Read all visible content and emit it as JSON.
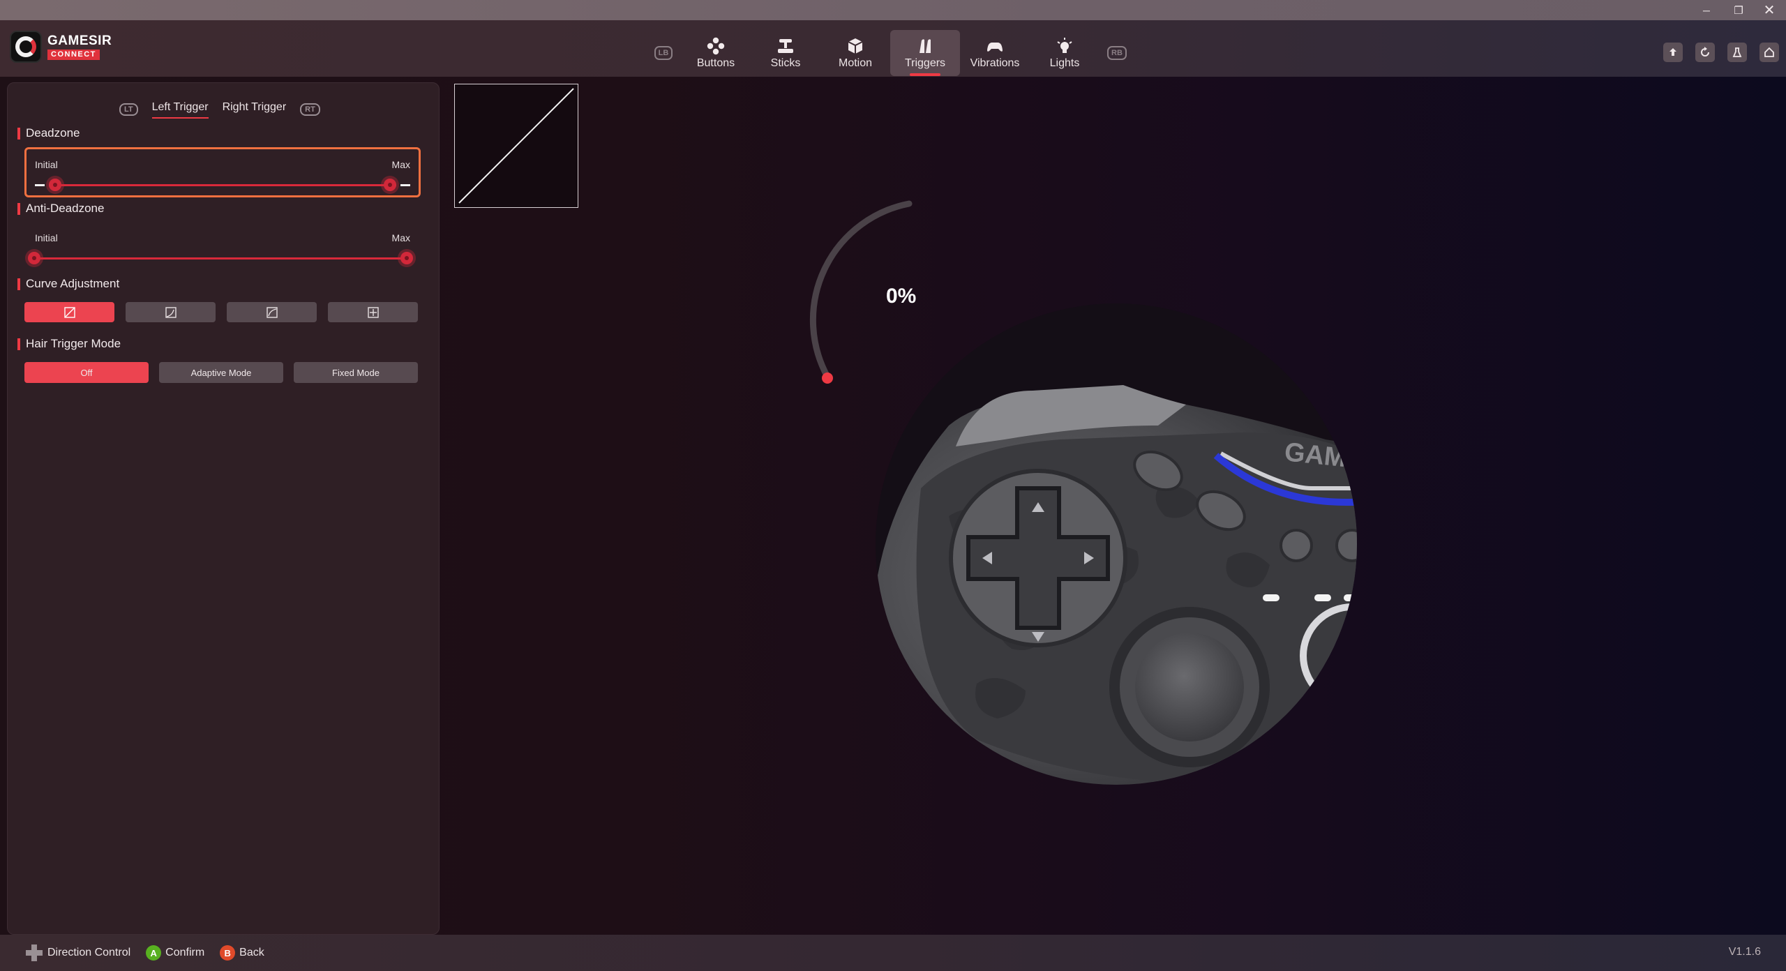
{
  "app": {
    "brand_line1": "GAMESIR",
    "brand_line2": "CONNECT",
    "version": "V1.1.6"
  },
  "window_controls": {
    "minimize_glyph": "─",
    "restore_glyph": "❐",
    "close_glyph": "✕"
  },
  "nav": {
    "left_bumper": "LB",
    "right_bumper": "RB",
    "active_tab": "Triggers",
    "tabs": [
      {
        "label": "Buttons",
        "icon": "buttons-icon"
      },
      {
        "label": "Sticks",
        "icon": "sticks-icon"
      },
      {
        "label": "Motion",
        "icon": "motion-icon"
      },
      {
        "label": "Triggers",
        "icon": "triggers-icon"
      },
      {
        "label": "Vibrations",
        "icon": "vibrations-icon"
      },
      {
        "label": "Lights",
        "icon": "lights-icon"
      }
    ],
    "tools": [
      "upload-icon",
      "reset-icon",
      "test-icon",
      "home-icon"
    ]
  },
  "trigger_tabs": {
    "left_key": "LT",
    "right_key": "RT",
    "left_label": "Left Trigger",
    "right_label": "Right Trigger",
    "active": "Left Trigger"
  },
  "deadzone": {
    "title": "Deadzone",
    "min_label": "Initial",
    "max_label": "Max",
    "initial_fraction": 0.05,
    "max_fraction": 0.95
  },
  "anti_deadzone": {
    "title": "Anti-Deadzone",
    "min_label": "Initial",
    "max_label": "Max",
    "initial_fraction": 0.0,
    "max_fraction": 1.0
  },
  "curve": {
    "title": "Curve Adjustment",
    "options": [
      "linear-curve-icon",
      "fast-curve-icon",
      "slow-curve-icon",
      "custom-curve-icon"
    ],
    "selected_index": 0
  },
  "hair_trigger": {
    "title": "Hair Trigger Mode",
    "options": [
      "Off",
      "Adaptive Mode",
      "Fixed Mode"
    ],
    "selected": "Off"
  },
  "trigger_readout": {
    "percent_text": "0%",
    "fraction": 0
  },
  "footer": {
    "direction_label": "Direction Control",
    "confirm_key": "A",
    "confirm_label": "Confirm",
    "back_key": "B",
    "back_label": "Back"
  },
  "colors": {
    "accent": "#ec4450",
    "confirm_green": "#58b020",
    "back_red": "#e04a2a",
    "focus_orange": "#f07040"
  }
}
